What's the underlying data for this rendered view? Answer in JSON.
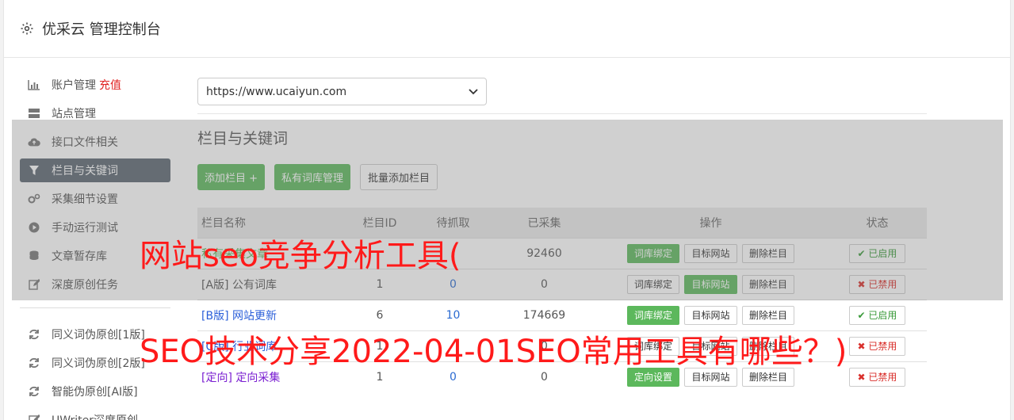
{
  "header": {
    "title": "优采云 管理控制台",
    "icon": "gear-icon"
  },
  "sidebar": {
    "items": [
      {
        "label": "账户管理",
        "extra": "充值",
        "icon": "bar-chart-icon"
      },
      {
        "label": "站点管理",
        "icon": "server-icon"
      },
      {
        "label": "接口文件相关",
        "icon": "cloud-upload-icon"
      },
      {
        "label": "栏目与关键词",
        "icon": "filter-icon",
        "active": true
      },
      {
        "label": "采集细节设置",
        "icon": "gears-icon"
      },
      {
        "label": "手动运行测试",
        "icon": "play-icon"
      },
      {
        "label": "文章暂存库",
        "icon": "database-icon"
      },
      {
        "label": "深度原创任务",
        "icon": "edit-icon"
      }
    ],
    "items2": [
      {
        "label": "同义词伪原创[1版]",
        "icon": "refresh-icon"
      },
      {
        "label": "同义词伪原创[2版]",
        "icon": "refresh-icon"
      },
      {
        "label": "智能伪原创[AI版]",
        "icon": "refresh-icon"
      },
      {
        "label": "UWriter深度原创",
        "icon": "edit-icon"
      }
    ]
  },
  "main": {
    "site_select": "https://www.ucaiyun.com",
    "section_title": "栏目与关键词",
    "buttons": {
      "add_column": "添加栏目 +",
      "private_lib": "私有词库管理",
      "batch_add": "批量添加栏目"
    },
    "table": {
      "headers": [
        "栏目名称",
        "栏目ID",
        "待抓取",
        "已采集",
        "操作",
        "状态"
      ],
      "rows": [
        {
          "prefix": "",
          "name": "私有采集文章",
          "id": "",
          "pending": "",
          "collected": "92460",
          "op1": "词库绑定",
          "op2": "目标网站",
          "op3": "删除栏目",
          "status": "已启用"
        },
        {
          "prefix": "[A版]",
          "name": "公有词库",
          "id": "1",
          "pending": "0",
          "collected": "0",
          "op1": "词库绑定",
          "op2": "目标网站",
          "op3": "删除栏目",
          "status": "已禁用"
        },
        {
          "prefix": "[B版]",
          "name": "网站更新",
          "id": "6",
          "pending": "10",
          "collected": "174669",
          "op1": "词库绑定",
          "op2": "目标网站",
          "op3": "删除栏目",
          "status": "已启用"
        },
        {
          "prefix": "[C版]",
          "name": "行业词库",
          "id": "1",
          "pending": "",
          "collected": "0",
          "op1": "词库绑定",
          "op2": "目标网站",
          "op3": "删除栏目",
          "status": "已禁用"
        },
        {
          "prefix": "[定向]",
          "name": "定向采集",
          "id": "1",
          "pending": "0",
          "collected": "0",
          "op1": "定向设置",
          "op2": "目标网站",
          "op3": "删除栏目",
          "status": "已禁用"
        }
      ]
    }
  },
  "overlay": {
    "line1": "网站seo竞争分析工具(",
    "line2": "SEO技术分享2022-04-01SEO常用工具有哪些？)"
  },
  "colors": {
    "accent_green": "#5cb85c",
    "sidebar_active": "#5b6670",
    "overlay_text": "#ff1a1a"
  }
}
